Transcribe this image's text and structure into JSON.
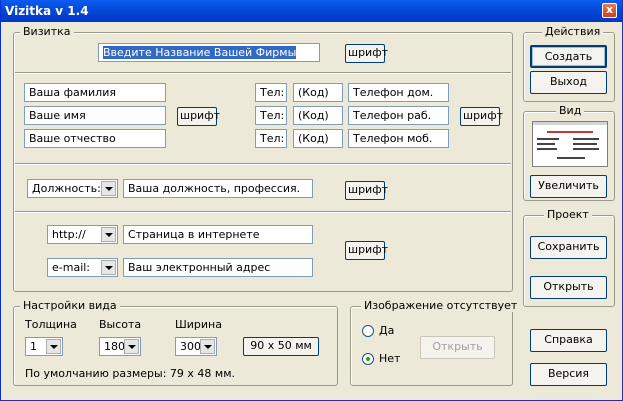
{
  "window": {
    "title": "Vizitka v 1.4",
    "close_glyph": "x"
  },
  "vizitka": {
    "legend": "Визитка",
    "company_name": "Введите Название Вашей Фирмы",
    "font_label": "шрифт",
    "surname": "Ваша фамилия",
    "name": "Ваше имя",
    "patronymic": "Ваше отчество",
    "phones": [
      {
        "tel": "Тел:",
        "code": "(Код)",
        "number": "Телефон дом."
      },
      {
        "tel": "Тел:",
        "code": "(Код)",
        "number": "Телефон раб."
      },
      {
        "tel": "Тел:",
        "code": "(Код)",
        "number": "Телефон моб."
      }
    ],
    "position_select": "Должность:",
    "position_value": "Ваша должность, профессия.",
    "protocol_select": "http://",
    "web_value": "Страница в интернете",
    "email_select": "e-mail:",
    "email_value": "Ваш электронный адрес"
  },
  "view_settings": {
    "legend": "Настройки вида",
    "thickness_label": "Толщина",
    "height_label": "Высота",
    "width_label": "Ширина",
    "thickness_value": "1",
    "height_value": "180",
    "width_value": "300",
    "size_button": "90 х 50 мм",
    "default_note": "По умолчанию размеры: 79 х 48 мм."
  },
  "image": {
    "legend": "Изображение отсутствует",
    "yes_label": "Да",
    "no_label": "Нет",
    "selected": "Нет",
    "open_button": "Открыть"
  },
  "actions": {
    "legend": "Действия",
    "create": "Создать",
    "exit": "Выход"
  },
  "view": {
    "legend": "Вид",
    "enlarge": "Увеличить"
  },
  "project": {
    "legend": "Проект",
    "save": "Сохранить",
    "open": "Открыть"
  },
  "help": "Справка",
  "version": "Версия"
}
